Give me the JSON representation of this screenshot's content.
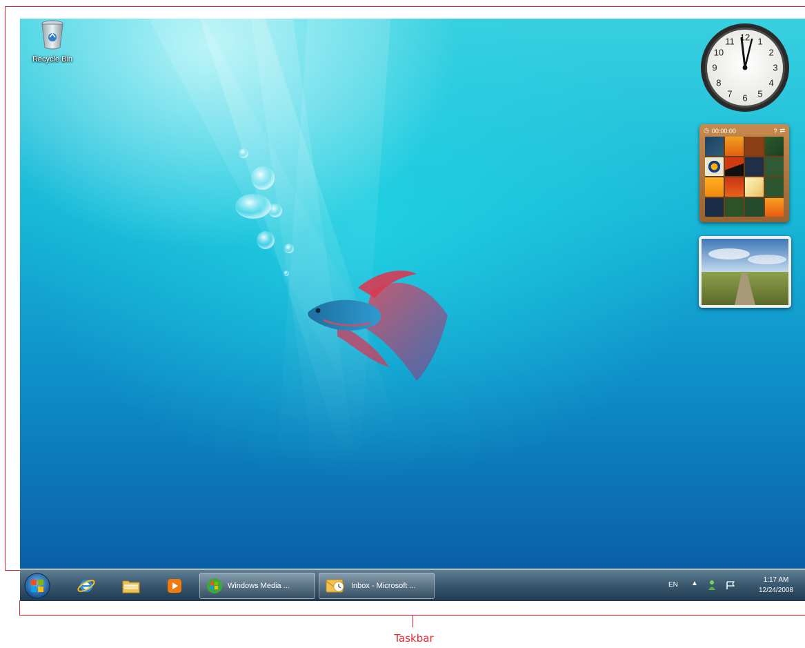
{
  "desktop": {
    "icons": [
      {
        "label": "Recycle Bin",
        "icon": "recycle-bin-icon"
      }
    ]
  },
  "gadgets": {
    "clock": {
      "hours_visible": [
        "12",
        "1",
        "2",
        "3",
        "4",
        "5",
        "6",
        "7",
        "8",
        "9",
        "10",
        "11"
      ]
    },
    "puzzle": {
      "timer": "00:00:00"
    },
    "slideshow": {
      "icon": "landscape-photo"
    }
  },
  "taskbar": {
    "start_icon": "windows-start-orb",
    "pinned": [
      {
        "icon": "internet-explorer-icon"
      },
      {
        "icon": "windows-explorer-icon"
      },
      {
        "icon": "media-player-icon"
      }
    ],
    "tasks": [
      {
        "label": "Windows Media ...",
        "icon": "windows-media-center-icon"
      },
      {
        "label": "Inbox - Microsoft ...",
        "icon": "outlook-icon"
      }
    ],
    "tray": {
      "language": "EN",
      "time": "1:17 AM",
      "date": "12/24/2008"
    }
  },
  "annotation": {
    "caption": "Taskbar",
    "color": "#e8262a"
  }
}
